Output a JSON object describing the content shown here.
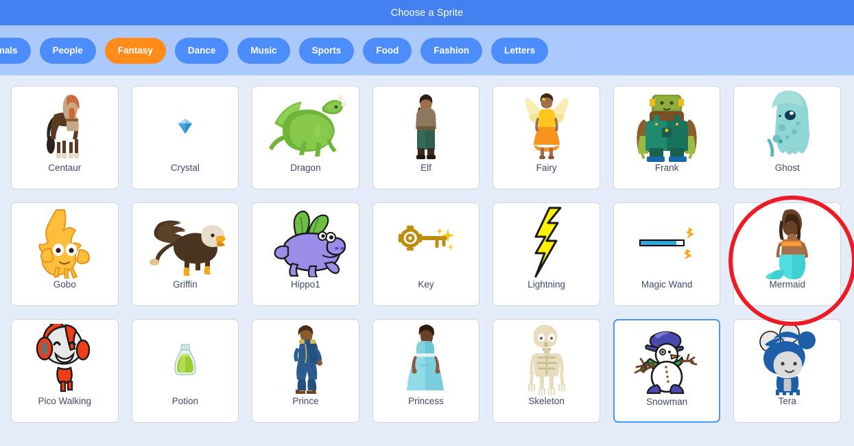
{
  "header": {
    "title": "Choose a Sprite"
  },
  "tabs": [
    {
      "label": "Animals",
      "selected": false,
      "cut": true
    },
    {
      "label": "People",
      "selected": false,
      "cut": false
    },
    {
      "label": "Fantasy",
      "selected": true,
      "cut": false
    },
    {
      "label": "Dance",
      "selected": false,
      "cut": false
    },
    {
      "label": "Music",
      "selected": false,
      "cut": false
    },
    {
      "label": "Sports",
      "selected": false,
      "cut": false
    },
    {
      "label": "Food",
      "selected": false,
      "cut": false
    },
    {
      "label": "Fashion",
      "selected": false,
      "cut": false
    },
    {
      "label": "Letters",
      "selected": false,
      "cut": false
    }
  ],
  "colors": {
    "header_blue": "#4280EF",
    "tabbar_blue": "#ABC9FC",
    "tab_blue": "#4C8CFB",
    "tab_selected_orange": "#FF8C1A",
    "body_background": "#E6EDFA",
    "card_white": "#FFFFFF",
    "card_border": "#D4D4D4",
    "card_selected_border": "#4C97FF",
    "label_text": "#3F4A69",
    "annotation_red": "#ED1C24"
  },
  "grid": {
    "rows": [
      [
        {
          "name": "Centaur",
          "icon": "centaur-sprite",
          "selected": false
        },
        {
          "name": "Crystal",
          "icon": "crystal-sprite",
          "selected": false
        },
        {
          "name": "Dragon",
          "icon": "dragon-sprite",
          "selected": false
        },
        {
          "name": "Elf",
          "icon": "elf-sprite",
          "selected": false
        },
        {
          "name": "Fairy",
          "icon": "fairy-sprite",
          "selected": false
        },
        {
          "name": "Frank",
          "icon": "frank-sprite",
          "selected": false
        },
        {
          "name": "Ghost",
          "icon": "ghost-sprite",
          "selected": false
        }
      ],
      [
        {
          "name": "Gobo",
          "icon": "gobo-sprite",
          "selected": false
        },
        {
          "name": "Griffin",
          "icon": "griffin-sprite",
          "selected": false
        },
        {
          "name": "Hippo1",
          "icon": "hippo1-sprite",
          "selected": false
        },
        {
          "name": "Key",
          "icon": "key-sprite",
          "selected": false
        },
        {
          "name": "Lightning",
          "icon": "lightning-sprite",
          "selected": false
        },
        {
          "name": "Magic Wand",
          "icon": "magic-wand-sprite",
          "selected": false
        },
        {
          "name": "Mermaid",
          "icon": "mermaid-sprite",
          "selected": false
        }
      ],
      [
        {
          "name": "Pico Walking",
          "icon": "pico-walking-sprite",
          "selected": false
        },
        {
          "name": "Potion",
          "icon": "potion-sprite",
          "selected": false
        },
        {
          "name": "Prince",
          "icon": "prince-sprite",
          "selected": false
        },
        {
          "name": "Princess",
          "icon": "princess-sprite",
          "selected": false
        },
        {
          "name": "Skeleton",
          "icon": "skeleton-sprite",
          "selected": false
        },
        {
          "name": "Snowman",
          "icon": "snowman-sprite",
          "selected": true
        },
        {
          "name": "Tera",
          "icon": "tera-sprite",
          "selected": false
        }
      ]
    ]
  },
  "annotation": {
    "shape": "red-ellipse",
    "targets": "Mermaid",
    "color": "#ED1C24",
    "stroke_width": 6
  }
}
